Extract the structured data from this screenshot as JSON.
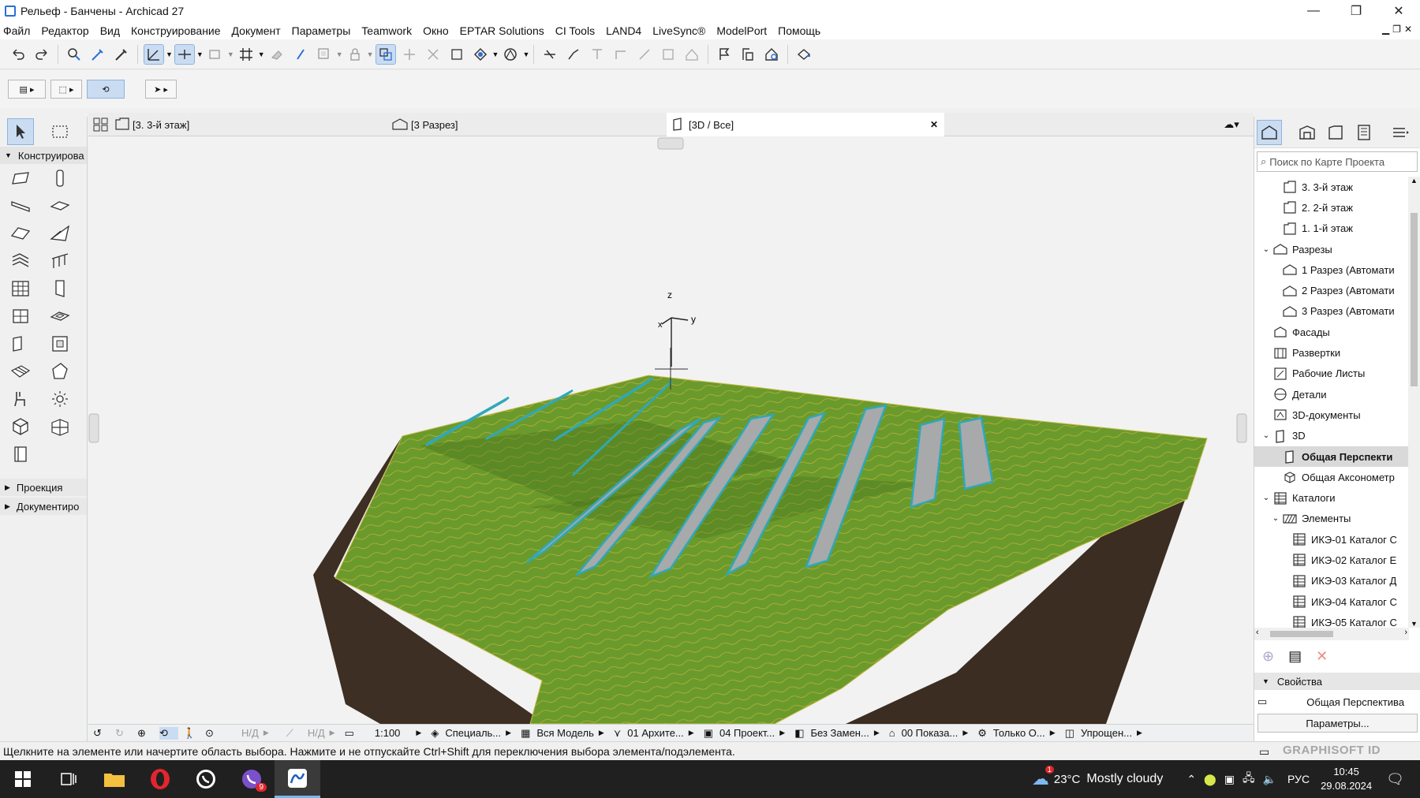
{
  "window": {
    "title": "Рельеф - Банчены - Archicad 27",
    "buttons": [
      "—",
      "❐",
      "✕"
    ]
  },
  "menu": [
    "Файл",
    "Редактор",
    "Вид",
    "Конструирование",
    "Документ",
    "Параметры",
    "Teamwork",
    "Окно",
    "EPTAR Solutions",
    "CI Tools",
    "LAND4",
    "LiveSync®",
    "ModelPort",
    "Помощь"
  ],
  "toolbox": {
    "design_header": "Конструирова",
    "projection_header": "Проекция",
    "document_header": "Документиро"
  },
  "tabs": [
    {
      "label": "[3. 3-й этаж]"
    },
    {
      "label": "[3 Разрез]"
    },
    {
      "label": "[3D / Все]",
      "close": "✕"
    }
  ],
  "viewport": {
    "axis_z": "z",
    "axis_y": "y",
    "axis_x": "x",
    "colors": {
      "terrain": "#6a9a2c",
      "contour": "#c6b43a",
      "cliff": "#3d2f23",
      "panel": "#a7a9ab",
      "panel_edge": "#2fa8b8"
    }
  },
  "bottombar": {
    "na1": "Н/Д",
    "na2": "Н/Д",
    "scale": "1:100",
    "structure": "Специаль...",
    "model": "Вся Модель",
    "layers": "01 Архите...",
    "pen": "04 Проект...",
    "override": "Без Замен...",
    "renovation": "00 Показа...",
    "mvo": "Только О...",
    "partial": "Упрощен..."
  },
  "status": "Щелкните на элементе или начертите область выбора. Нажмите и не отпускайте Ctrl+Shift для переключения выбора элемента/подэлемента.",
  "brand": "GRAPHISOFT ID",
  "navigator": {
    "search_placeholder": "Поиск по Карте Проекта",
    "tree": [
      {
        "label": "3. 3-й этаж",
        "indent": 2,
        "icon": "story"
      },
      {
        "label": "2. 2-й этаж",
        "indent": 2,
        "icon": "story"
      },
      {
        "label": "1. 1-й этаж",
        "indent": 2,
        "icon": "story"
      },
      {
        "label": "Разрезы",
        "indent": 1,
        "icon": "section",
        "exp": "v"
      },
      {
        "label": "1 Разрез (Автомати",
        "indent": 2,
        "icon": "section"
      },
      {
        "label": "2 Разрез (Автомати",
        "indent": 2,
        "icon": "section"
      },
      {
        "label": "3 Разрез (Автомати",
        "indent": 2,
        "icon": "section"
      },
      {
        "label": "Фасады",
        "indent": 1,
        "icon": "elevation"
      },
      {
        "label": "Развертки",
        "indent": 1,
        "icon": "interior"
      },
      {
        "label": "Рабочие Листы",
        "indent": 1,
        "icon": "worksheet"
      },
      {
        "label": "Детали",
        "indent": 1,
        "icon": "detail"
      },
      {
        "label": "3D-документы",
        "indent": 1,
        "icon": "doc3d"
      },
      {
        "label": "3D",
        "indent": 1,
        "icon": "threed",
        "exp": "v"
      },
      {
        "label": "Общая Перспекти",
        "indent": 2,
        "icon": "persp",
        "selected": true
      },
      {
        "label": "Общая Аксонометр",
        "indent": 2,
        "icon": "axo"
      },
      {
        "label": "Каталоги",
        "indent": 1,
        "icon": "schedule",
        "exp": "v"
      },
      {
        "label": "Элементы",
        "indent": 2,
        "icon": "hatch",
        "exp": "v"
      },
      {
        "label": "ИКЭ-01 Каталог С",
        "indent": 3,
        "icon": "schedule"
      },
      {
        "label": "ИКЭ-02 Каталог E",
        "indent": 3,
        "icon": "schedule"
      },
      {
        "label": "ИКЭ-03 Каталог Д",
        "indent": 3,
        "icon": "schedule"
      },
      {
        "label": "ИКЭ-04 Каталог С",
        "indent": 3,
        "icon": "schedule"
      },
      {
        "label": "ИКЭ-05 Каталог С",
        "indent": 3,
        "icon": "schedule"
      }
    ],
    "properties_header": "Свойства",
    "properties_value": "Общая Перспектива",
    "params_button": "Параметры..."
  },
  "taskbar": {
    "weather_temp": "23°C",
    "weather_text": "Mostly cloudy",
    "lang": "РУС",
    "time": "10:45",
    "date": "29.08.2024",
    "viber_badge": "9",
    "weather_badge": "1"
  }
}
